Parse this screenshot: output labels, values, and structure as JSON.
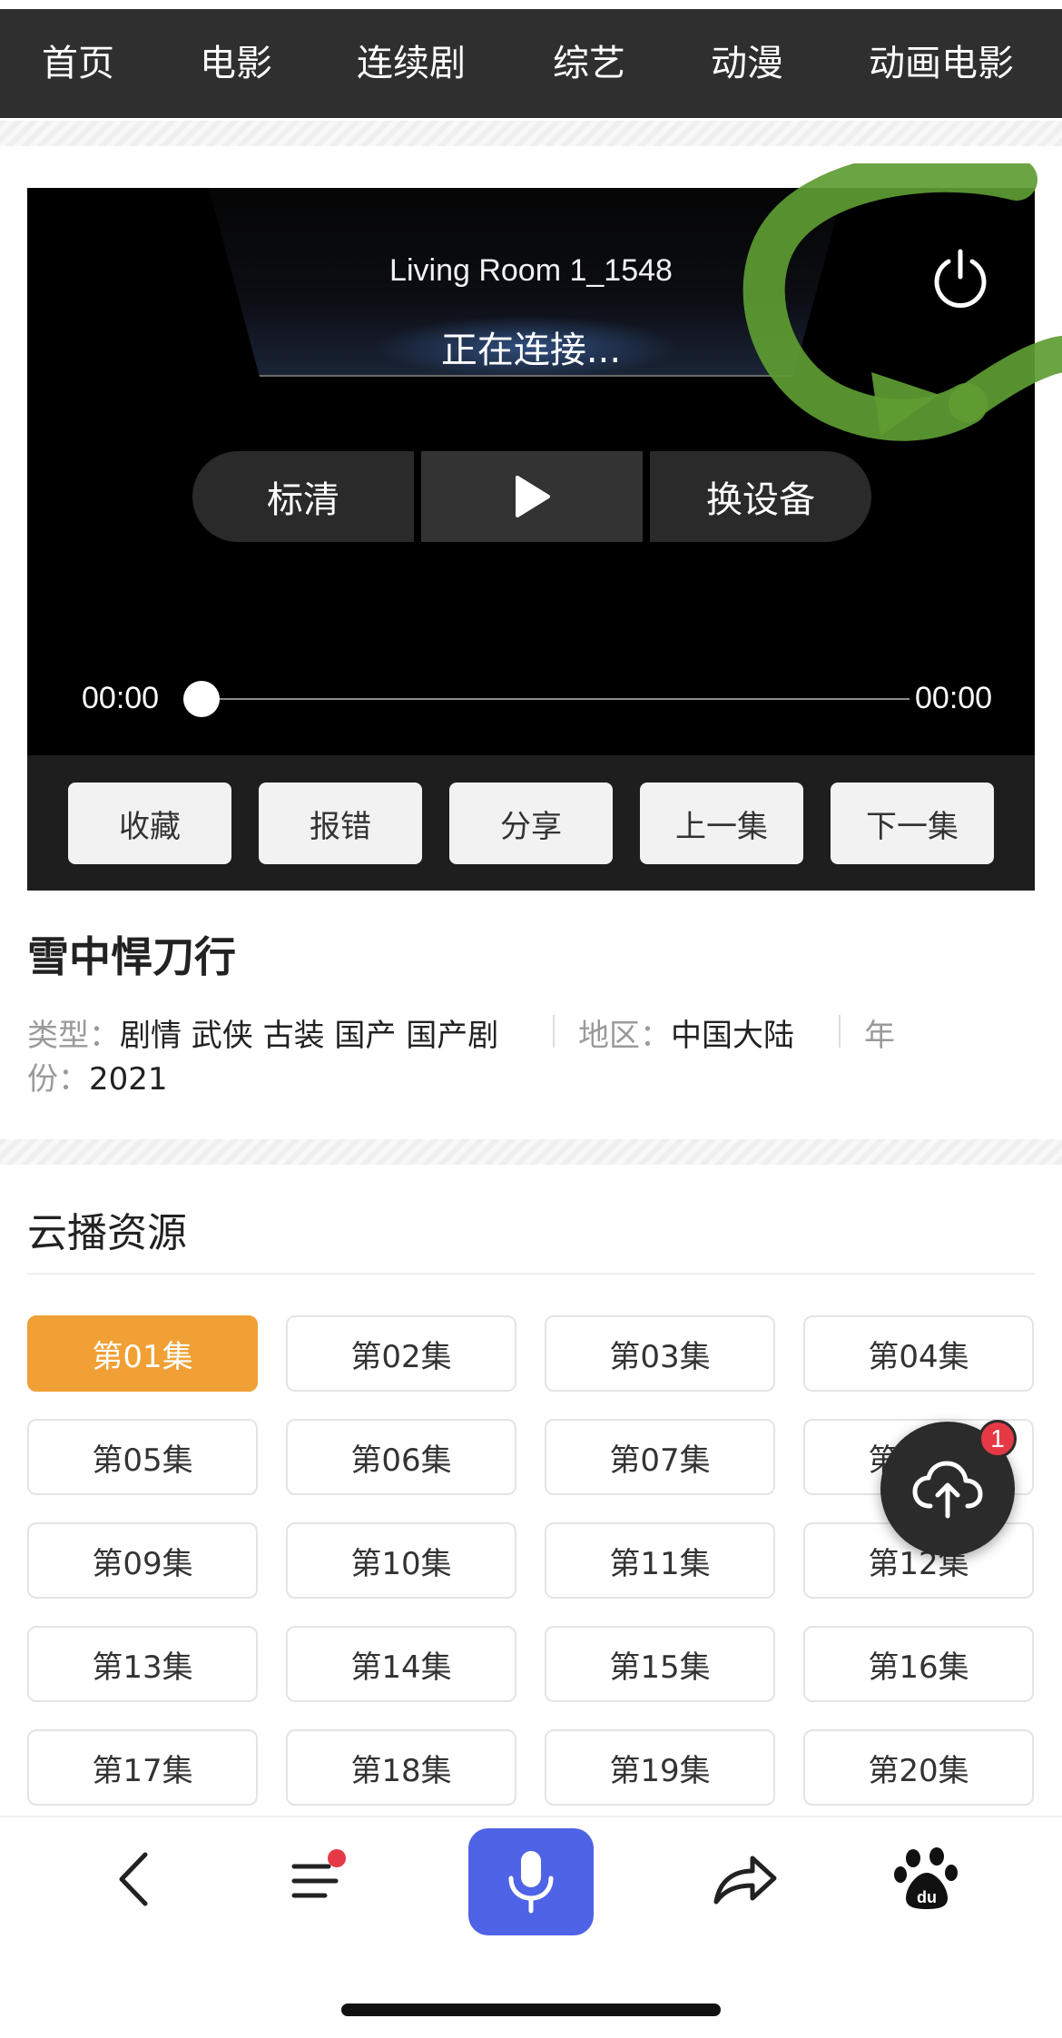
{
  "nav": {
    "items": [
      "首页",
      "电影",
      "连续剧",
      "综艺",
      "动漫",
      "动画电影"
    ]
  },
  "player": {
    "device_name": "Living Room 1_1548",
    "status": "正在连接...",
    "quality_label": "标清",
    "switch_device_label": "换设备",
    "time_current": "00:00",
    "time_total": "00:00",
    "progress": 0,
    "power_icon": "power-icon",
    "play_icon": "play-icon"
  },
  "actions": [
    "收藏",
    "报错",
    "分享",
    "上一集",
    "下一集"
  ],
  "show": {
    "title": "雪中悍刀行",
    "genre_label": "类型：",
    "genres": "剧情 武侠 古装 国产 国产剧",
    "region_label": "地区：",
    "region": "中国大陆",
    "year_label_1": "年",
    "year_label_2": "份：",
    "year": "2021"
  },
  "source": {
    "title": "云播资源",
    "episodes": [
      "第01集",
      "第02集",
      "第03集",
      "第04集",
      "第05集",
      "第06集",
      "第07集",
      "第08集",
      "第09集",
      "第10集",
      "第11集",
      "第12集",
      "第13集",
      "第14集",
      "第15集",
      "第16集",
      "第17集",
      "第18集",
      "第19集",
      "第20集"
    ],
    "active_index": 0,
    "active_color": "#f0a035"
  },
  "fab": {
    "icon": "cloud-upload-icon",
    "badge": "1"
  },
  "bottom_bar": {
    "icons": [
      "back-icon",
      "menu-icon",
      "mic-icon",
      "share-icon",
      "baidu-paw-icon"
    ],
    "mic_color": "#4f63e6"
  }
}
